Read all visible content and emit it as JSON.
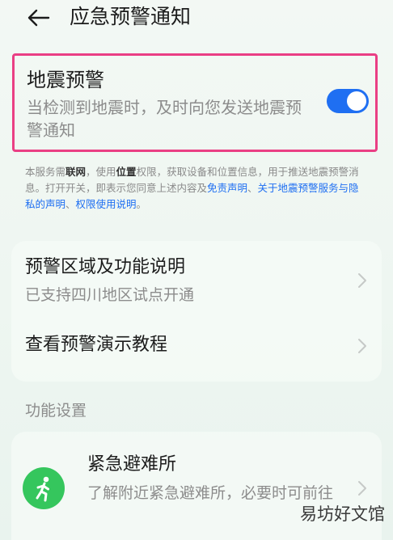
{
  "header": {
    "title": "应急预警通知"
  },
  "earthquake": {
    "title": "地震预警",
    "description": "当检测到地震时，及时向您发送地震预警通知",
    "toggle_on": true
  },
  "notice": {
    "p1": "本服务需",
    "b1": "联网",
    "p2": "，使用",
    "b2": "位置",
    "p3": "权限，获取设备和位置信息，用于推送地震预警消息。打开开关，即表示您同意上述内容及",
    "link1": "免责声明",
    "sep1": "、",
    "link2": "关于地震预警服务与隐私的声明",
    "sep2": "、",
    "link3": "权限使用说明",
    "end": "。"
  },
  "menu": {
    "region": {
      "title": "预警区域及功能说明",
      "subtitle": "已支持四川地区试点开通"
    },
    "tutorial": {
      "title": "查看预警演示教程"
    }
  },
  "settings": {
    "label": "功能设置",
    "shelter": {
      "title": "紧急避难所",
      "description": "了解附近紧急避难所，必要时可前往"
    }
  },
  "watermark": "易坊好文馆",
  "colors": {
    "accent": "#1f6ff2",
    "highlight_border": "#ea3f84",
    "shelter_icon_bg": "#35c65d"
  }
}
